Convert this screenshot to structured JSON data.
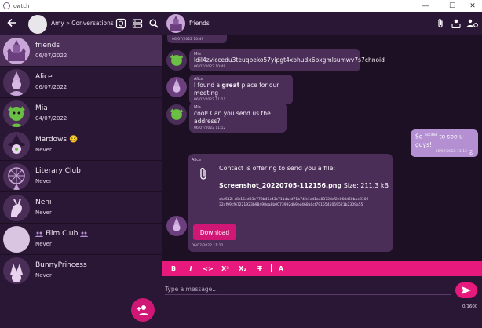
{
  "window": {
    "title": "cwtch",
    "minimize": "—",
    "maximize": "☐",
    "close": "✕"
  },
  "left_header": {
    "title": "Amy » Conversations"
  },
  "contacts": [
    {
      "name": "friends",
      "date": "06/07/2022"
    },
    {
      "name": "Alice",
      "date": "06/07/2022"
    },
    {
      "name": "Mia",
      "date": "04/07/2022"
    },
    {
      "name": "Mardows 🥴",
      "date": "Never"
    },
    {
      "name": "Literary Club",
      "date": "Never"
    },
    {
      "name": "Neni",
      "date": "Never"
    },
    {
      "name": "Film Club",
      "date": "Never"
    },
    {
      "name": "BunnyPrincess",
      "date": "Never"
    }
  ],
  "conversation": {
    "title": "friends"
  },
  "messages": {
    "m0": {
      "time": "06/07/2022 10:49"
    },
    "m1": {
      "sender": "Mia",
      "text": "ldil4zviccedu3teuqbeko57yipgt4xbhudx6bxgmlsumwv7s7chnoid",
      "time": "06/07/2022 10:49"
    },
    "m2": {
      "sender": "Alice",
      "pre": "I found a ",
      "bold": "great",
      "post": " place for our meeting",
      "time": "06/07/2022 11:11"
    },
    "m3": {
      "sender": "Mia",
      "text": "cool! Can you send us the address?",
      "time": "06/07/2022 11:12"
    },
    "m4": {
      "pre": "So ",
      "sup": "excited",
      "post": " to see u guys!",
      "time": "06/07/2022 11:12"
    },
    "file": {
      "sender": "Alice",
      "offer": "Contact is offering to send you a file:",
      "filename": "Screenshot_20220705-112156.png",
      "size": "Size: 211.3 kB",
      "hash_line1": "sha512: c8c15ed03e773b46c43c711dacd71b74fc1cd1ae8372dcf2e068d60bae8102",
      "hash_line2": "324f99cf67221923b98498ea8b0073992db9ec468a0cf7915545059521b2309a55",
      "download": "Download",
      "time": "06/07/2022 11:12"
    }
  },
  "toolbar": {
    "bold": "B",
    "italic": "I",
    "code": "<>",
    "sup": "X²",
    "sub": "X₂",
    "strike": "T",
    "link": "A"
  },
  "compose": {
    "placeholder": "Type a message...",
    "counter": "0/1600"
  },
  "colors": {
    "accent": "#e8197d",
    "button": "#d01776",
    "bubble": "#4b2e58",
    "own_bubble": "#b48fd2",
    "background": "#1d1024",
    "panel": "#2a1735"
  }
}
